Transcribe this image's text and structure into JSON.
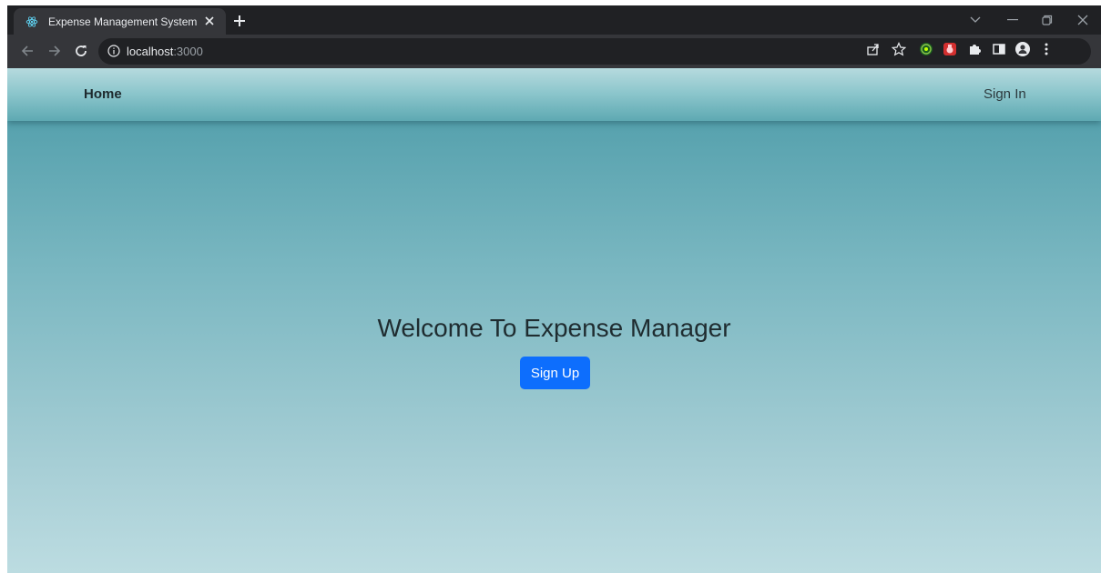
{
  "browser": {
    "tab": {
      "title": "Expense Management System",
      "favicon": "react-icon"
    },
    "address": {
      "host": "localhost",
      "port": ":3000"
    },
    "icons": [
      "back-icon",
      "forward-icon",
      "reload-icon",
      "info-icon",
      "share-icon",
      "star-icon",
      "extension-icon",
      "puzzle-icon",
      "sidepanel-icon",
      "profile-icon",
      "more-icon"
    ]
  },
  "navbar": {
    "home_label": "Home",
    "signin_label": "Sign In"
  },
  "hero": {
    "title": "Welcome To Expense Manager",
    "signup_label": "Sign Up"
  },
  "colors": {
    "accent": "#0d6efd",
    "chrome_dark": "#202124",
    "chrome_toolbar": "#35363a"
  }
}
